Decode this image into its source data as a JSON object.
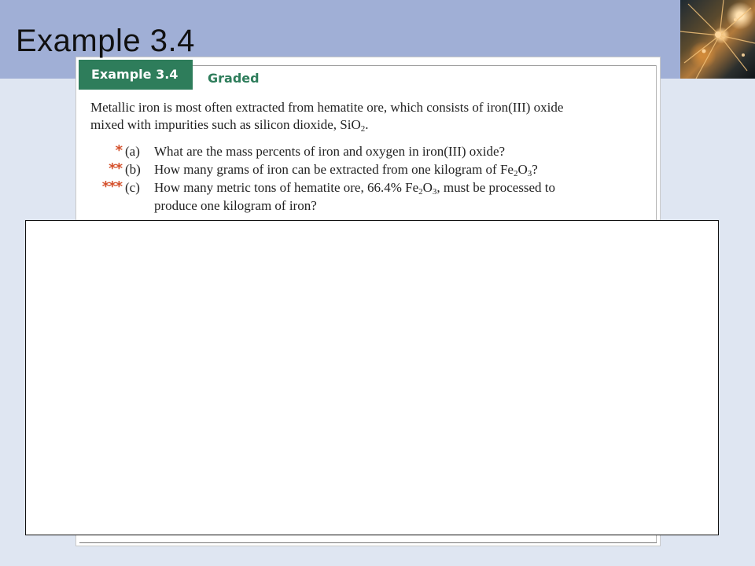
{
  "slide": {
    "title": "Example 3.4"
  },
  "textbook": {
    "heading": "Example 3.4",
    "tag": "Graded",
    "intro": [
      "Metallic iron is most often extracted from hematite ore, which consists of iron(III) oxide",
      "mixed with impurities such as silicon dioxide, SiO",
      "2",
      "."
    ],
    "questions": [
      {
        "stars": "*",
        "letter": "(a)",
        "line1": "What are the mass percents of iron and oxygen in iron(III) oxide?"
      },
      {
        "stars": "**",
        "letter": "(b)",
        "line1_pre": "How many grams of iron can be extracted from one kilogram of Fe",
        "sub1": "2",
        "mid": "O",
        "sub2": "3",
        "line1_post": "?"
      },
      {
        "stars": "***",
        "letter": "(c)",
        "line1_pre": "How many metric tons of hematite ore, 66.4% Fe",
        "sub1": "2",
        "mid": "O",
        "sub2": "3",
        "line1_post": ", must be processed to",
        "line2": "produce one kilogram of iron?"
      }
    ]
  },
  "colors": {
    "band": "#a0afd6",
    "background": "#dfe6f2",
    "heading_green": "#2e7d5b",
    "star_orange": "#d4502b"
  }
}
